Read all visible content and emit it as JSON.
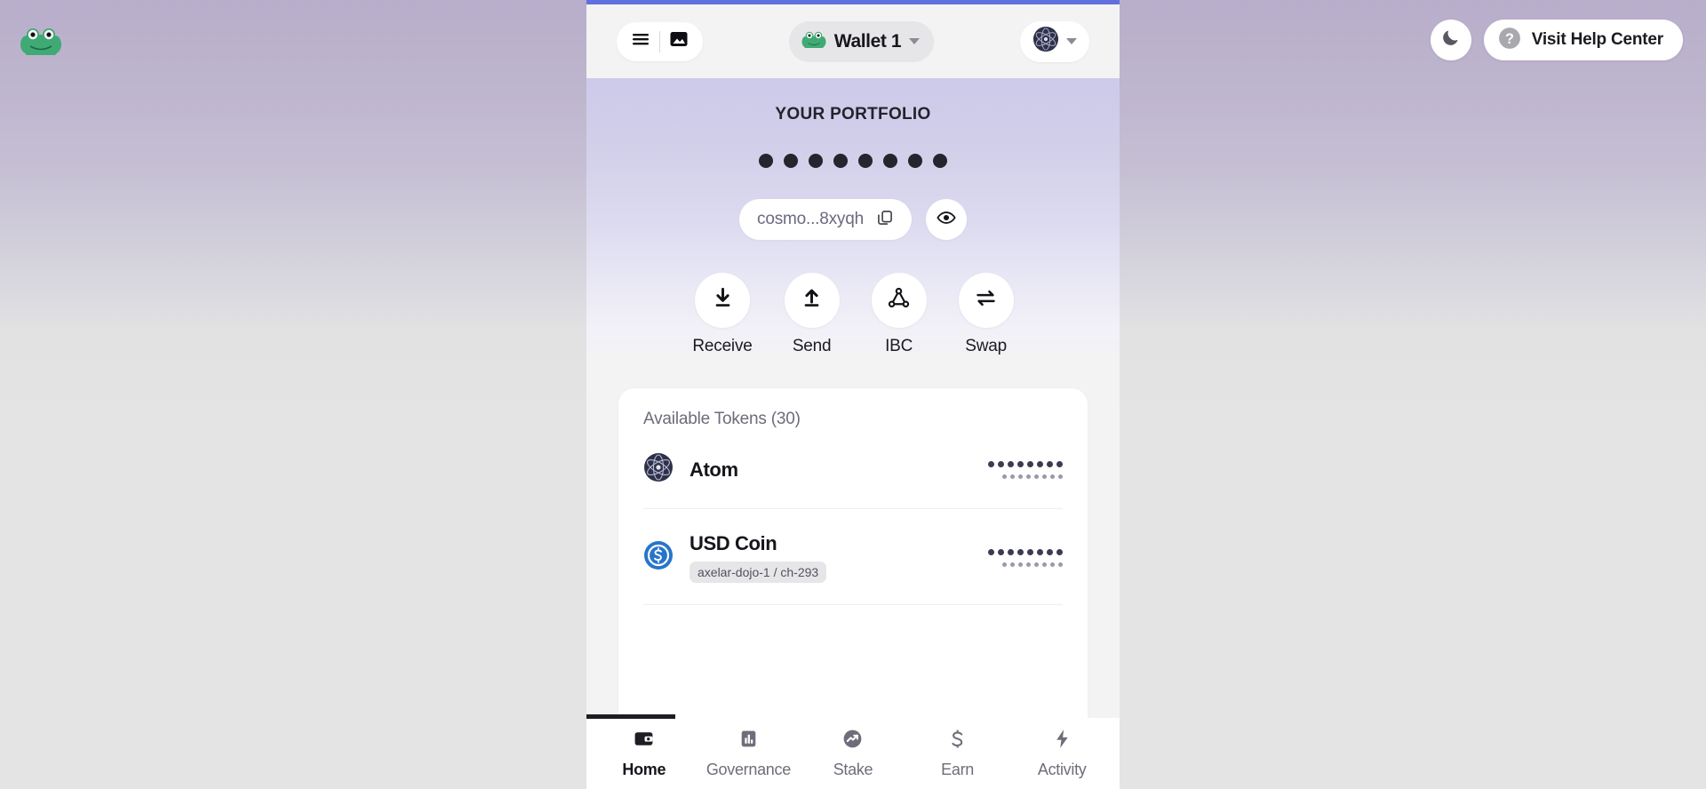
{
  "desktop": {
    "logo_icon": "frog-logo-icon",
    "theme_toggle": {
      "icon": "moon-icon",
      "label": "Dark mode"
    },
    "help": {
      "icon": "question-mark-icon",
      "label": "Visit Help Center"
    }
  },
  "app_header": {
    "menu_icon": "hamburger-menu-icon",
    "image_icon": "image-picture-icon",
    "wallet": {
      "avatar_icon": "frog-avatar-icon",
      "name": "Wallet 1",
      "caret_icon": "chevron-down-icon"
    },
    "network": {
      "avatar_icon": "cosmos-atom-icon",
      "caret_icon": "chevron-down-icon"
    }
  },
  "hero": {
    "title": "YOUR PORTFOLIO",
    "balance_hidden": true,
    "balance_dot_count": 8,
    "address": {
      "text": "cosmo...8xyqh",
      "copy_icon": "copy-icon"
    },
    "visibility_toggle_icon": "eye-icon",
    "actions": [
      {
        "label": "Receive",
        "icon": "download-arrow-icon"
      },
      {
        "label": "Send",
        "icon": "upload-arrow-icon"
      },
      {
        "label": "IBC",
        "icon": "network-nodes-icon"
      },
      {
        "label": "Swap",
        "icon": "swap-arrows-icon"
      }
    ]
  },
  "tokens": {
    "title": "Available Tokens (30)",
    "count": 30,
    "rows": [
      {
        "name": "Atom",
        "icon": "cosmos-atom-token-icon",
        "badge": null,
        "amount_hidden": true,
        "amount_dot_count": 8,
        "value_dot_count": 8
      },
      {
        "name": "USD Coin",
        "icon": "usd-coin-token-icon",
        "badge": "axelar-dojo-1 / ch-293",
        "amount_hidden": true,
        "amount_dot_count": 8,
        "value_dot_count": 8
      }
    ]
  },
  "bottom_nav": {
    "active": "Home",
    "items": [
      {
        "label": "Home",
        "icon": "wallet-icon"
      },
      {
        "label": "Governance",
        "icon": "bar-chart-icon"
      },
      {
        "label": "Stake",
        "icon": "trending-up-icon"
      },
      {
        "label": "Earn",
        "icon": "dollar-sign-icon"
      },
      {
        "label": "Activity",
        "icon": "lightning-bolt-icon"
      }
    ]
  },
  "colors": {
    "accent_border": "#6170dd",
    "panel_bg": "#f3f3f4",
    "hero_top": "#cdcaea",
    "page_bg_top": "#b8aecb",
    "page_bg_bottom": "#e4e4e4",
    "text_primary": "#15151b",
    "text_muted": "#6c6c7c",
    "frog_green": "#3faa74",
    "usdc_blue": "#2775ca",
    "atom_navy": "#2e3148"
  }
}
